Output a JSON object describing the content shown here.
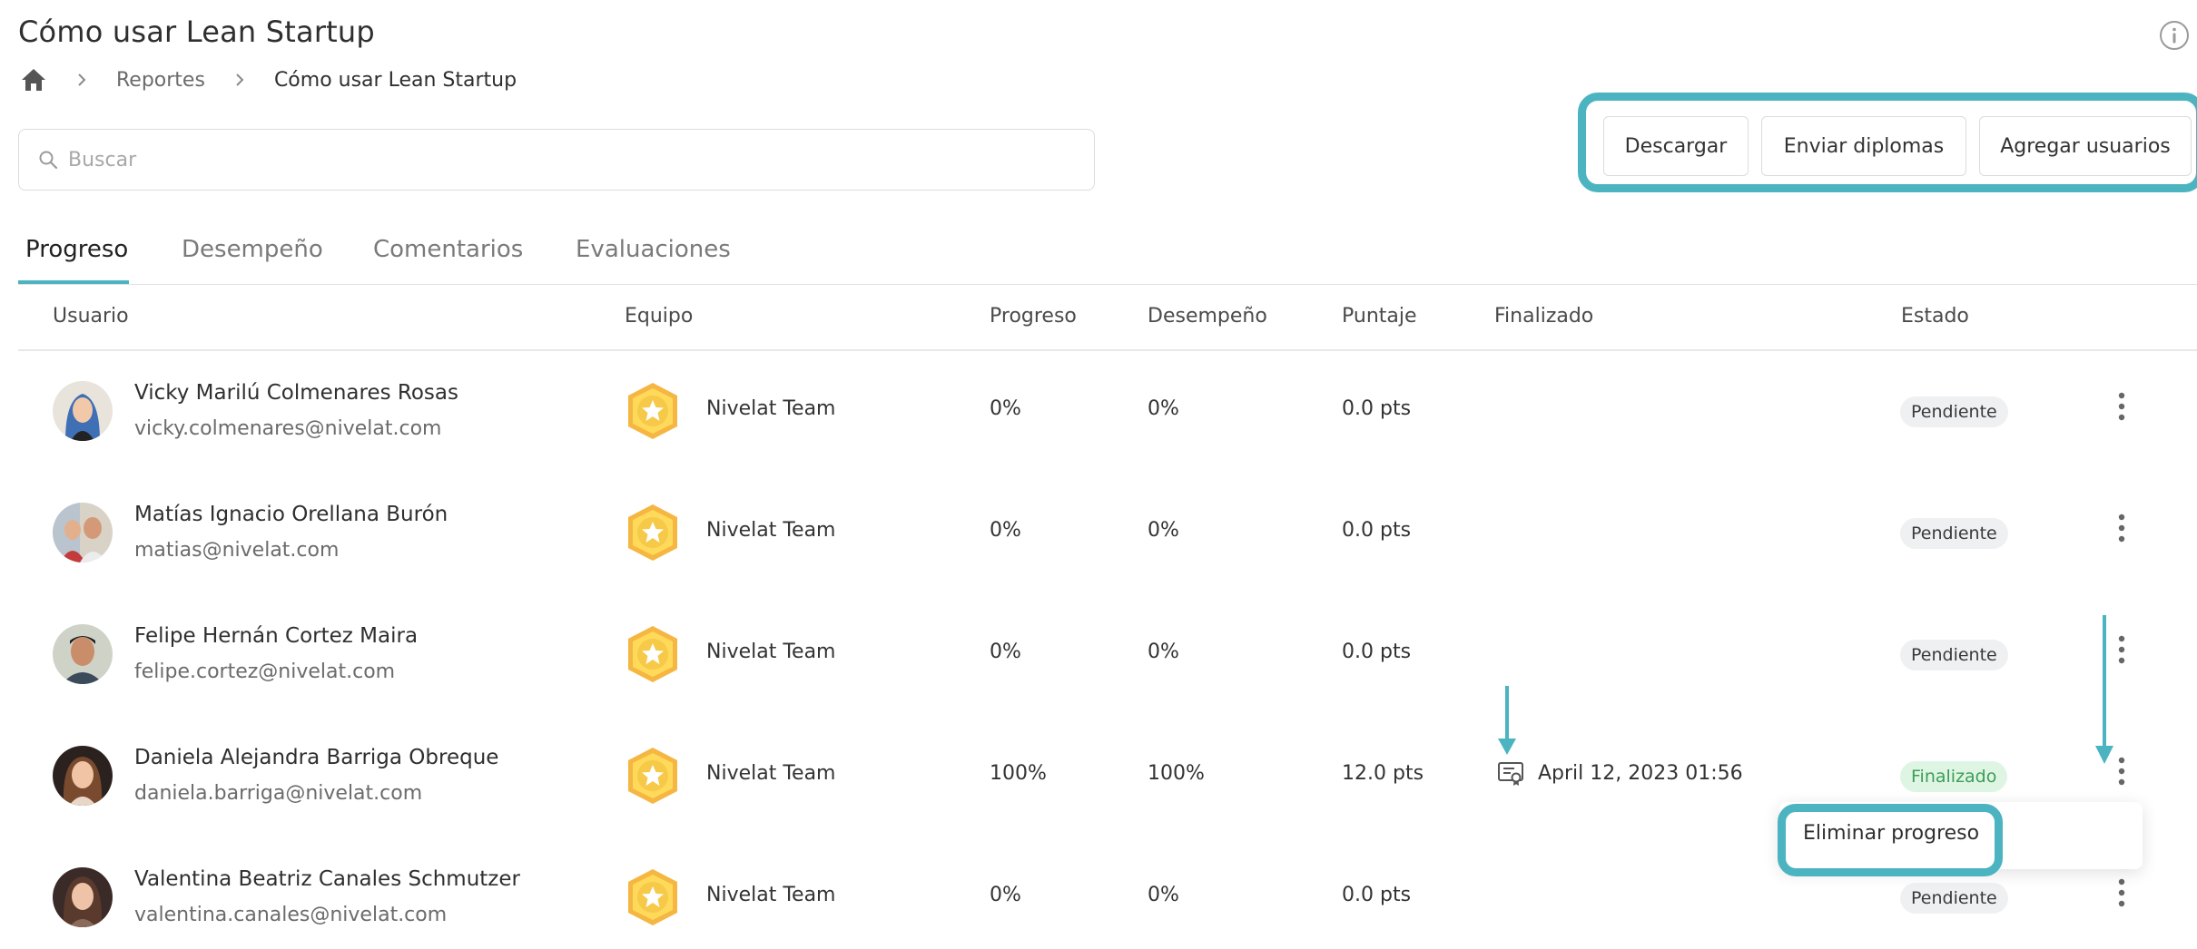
{
  "page": {
    "title": "Cómo usar Lean Startup"
  },
  "breadcrumb": {
    "items": [
      "Reportes",
      "Cómo usar Lean Startup"
    ]
  },
  "search": {
    "placeholder": "Buscar"
  },
  "actions": {
    "download": "Descargar",
    "send_diplomas": "Enviar diplomas",
    "add_users": "Agregar usuarios"
  },
  "tabs": [
    "Progreso",
    "Desempeño",
    "Comentarios",
    "Evaluaciones"
  ],
  "table": {
    "columns": [
      "Usuario",
      "Equipo",
      "Progreso",
      "Desempeño",
      "Puntaje",
      "Finalizado",
      "Estado"
    ],
    "rows": [
      {
        "name": "Vicky Marilú Colmenares Rosas",
        "email": "vicky.colmenares@nivelat.com",
        "team": "Nivelat Team",
        "progress": "0%",
        "performance": "0%",
        "score": "0.0 pts",
        "finished": "",
        "status": "Pendiente"
      },
      {
        "name": "Matías Ignacio Orellana Burón",
        "email": "matias@nivelat.com",
        "team": "Nivelat Team",
        "progress": "0%",
        "performance": "0%",
        "score": "0.0 pts",
        "finished": "",
        "status": "Pendiente"
      },
      {
        "name": "Felipe Hernán Cortez Maira",
        "email": "felipe.cortez@nivelat.com",
        "team": "Nivelat Team",
        "progress": "0%",
        "performance": "0%",
        "score": "0.0 pts",
        "finished": "",
        "status": "Pendiente"
      },
      {
        "name": "Daniela Alejandra Barriga Obreque",
        "email": "daniela.barriga@nivelat.com",
        "team": "Nivelat Team",
        "progress": "100%",
        "performance": "100%",
        "score": "12.0 pts",
        "finished": "April 12, 2023 01:56",
        "status": "Finalizado"
      },
      {
        "name": "Valentina Beatriz Canales Schmutzer",
        "email": "valentina.canales@nivelat.com",
        "team": "Nivelat Team",
        "progress": "0%",
        "performance": "0%",
        "score": "0.0 pts",
        "finished": "",
        "status": "Pendiente"
      }
    ]
  },
  "row_menu": {
    "delete_progress": "Eliminar progreso"
  },
  "colors": {
    "accent": "#4bb4c0",
    "finished_bg": "#dff5e4",
    "finished_text": "#3c9e55",
    "pending_bg": "#eef0f2"
  },
  "icons": [
    "home-icon",
    "chevron-right-icon",
    "search-icon",
    "info-icon",
    "team-badge-icon",
    "diploma-icon",
    "kebab-menu-icon"
  ]
}
